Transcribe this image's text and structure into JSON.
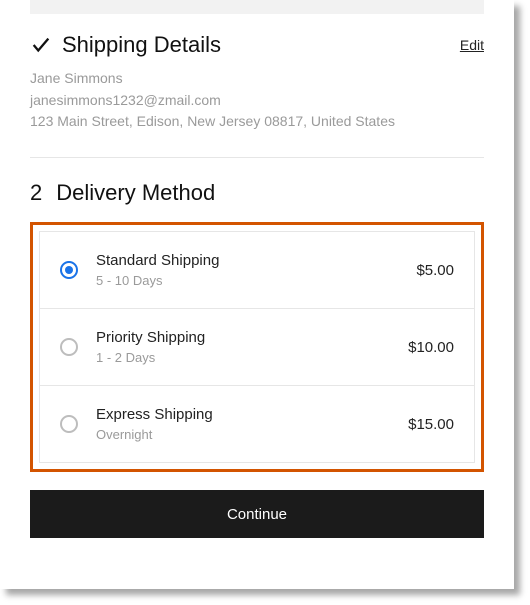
{
  "shipping": {
    "title": "Shipping Details",
    "edit_label": "Edit",
    "name": "Jane Simmons",
    "email": "janesimmons1232@zmail.com",
    "address": "123 Main Street, Edison, New Jersey 08817, United States"
  },
  "delivery": {
    "step_number": "2",
    "title": "Delivery Method",
    "options": [
      {
        "name": "Standard Shipping",
        "sub": "5 - 10 Days",
        "price": "$5.00",
        "selected": true
      },
      {
        "name": "Priority Shipping",
        "sub": "1 - 2 Days",
        "price": "$10.00",
        "selected": false
      },
      {
        "name": "Express Shipping",
        "sub": "Overnight",
        "price": "$15.00",
        "selected": false
      }
    ]
  },
  "actions": {
    "continue_label": "Continue"
  }
}
